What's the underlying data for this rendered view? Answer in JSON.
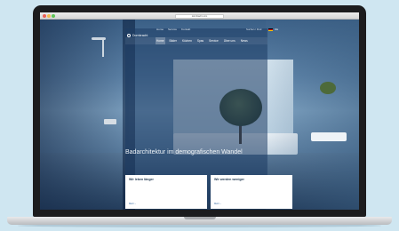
{
  "browser": {
    "address": "dornbracht.com"
  },
  "site": {
    "logo_text": "Dornbracht",
    "topnav": [
      "Home",
      "Service",
      "Kontakt"
    ],
    "search_placeholder": "Suchen / Find",
    "language": "DE",
    "mainnav": [
      "Home",
      "Bäder",
      "Küchen",
      "Spas",
      "Service",
      "Über uns",
      "News"
    ],
    "mainnav_active_index": 0,
    "hero_title": "Badarchitektur im demografischen Wandel",
    "cards": [
      {
        "title": "Wir leben länger",
        "text": "",
        "link": "Mehr ›"
      },
      {
        "title": "Wir werden weniger",
        "text": "",
        "link": "Mehr ›"
      }
    ]
  }
}
